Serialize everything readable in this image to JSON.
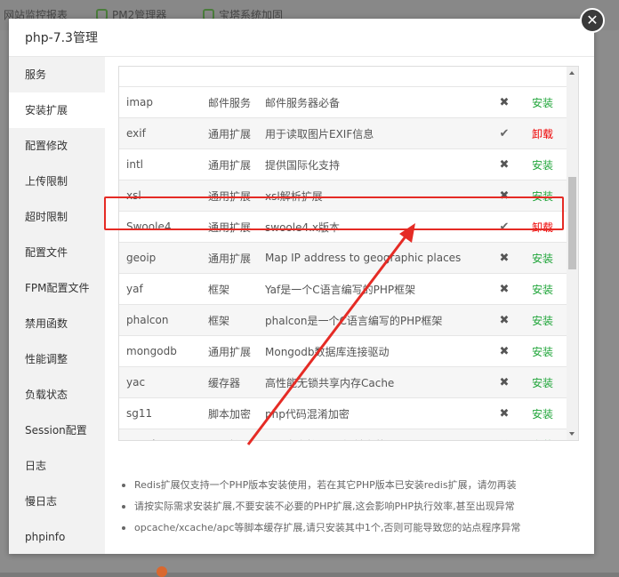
{
  "background": {
    "tabs": [
      "网站监控报表",
      "PM2管理器",
      "宝塔系统加固"
    ]
  },
  "modal": {
    "title": "php-7.3管理",
    "close_icon": "close-icon"
  },
  "sidebar": {
    "items": [
      {
        "label": "服务"
      },
      {
        "label": "安装扩展"
      },
      {
        "label": "配置修改"
      },
      {
        "label": "上传限制"
      },
      {
        "label": "超时限制"
      },
      {
        "label": "配置文件"
      },
      {
        "label": "FPM配置文件"
      },
      {
        "label": "禁用函数"
      },
      {
        "label": "性能调整"
      },
      {
        "label": "负载状态"
      },
      {
        "label": "Session配置"
      },
      {
        "label": "日志"
      },
      {
        "label": "慢日志"
      },
      {
        "label": "phpinfo"
      }
    ],
    "active_index": 1
  },
  "extensions": {
    "rows": [
      {
        "name": "imap",
        "type": "邮件服务",
        "desc": "邮件服务器必备",
        "installed": false,
        "status": "✖",
        "action": "安装"
      },
      {
        "name": "exif",
        "type": "通用扩展",
        "desc": "用于读取图片EXIF信息",
        "installed": true,
        "status": "✔",
        "action": "卸载"
      },
      {
        "name": "intl",
        "type": "通用扩展",
        "desc": "提供国际化支持",
        "installed": false,
        "status": "✖",
        "action": "安装"
      },
      {
        "name": "xsl",
        "type": "通用扩展",
        "desc": "xsl解析扩展",
        "installed": false,
        "status": "✖",
        "action": "安装"
      },
      {
        "name": "Swoole4",
        "type": "通用扩展",
        "desc": "swoole4.x版本",
        "installed": true,
        "status": "✔",
        "action": "卸载"
      },
      {
        "name": "geoip",
        "type": "通用扩展",
        "desc": "Map IP address to geographic places",
        "installed": false,
        "status": "✖",
        "action": "安装"
      },
      {
        "name": "yaf",
        "type": "框架",
        "desc": "Yaf是一个C语言编写的PHP框架",
        "installed": false,
        "status": "✖",
        "action": "安装"
      },
      {
        "name": "phalcon",
        "type": "框架",
        "desc": "phalcon是一个C语言编写的PHP框架",
        "installed": false,
        "status": "✖",
        "action": "安装"
      },
      {
        "name": "mongodb",
        "type": "通用扩展",
        "desc": "Mongodb数据库连接驱动",
        "installed": false,
        "status": "✖",
        "action": "安装"
      },
      {
        "name": "yac",
        "type": "缓存器",
        "desc": "高性能无锁共享内存Cache",
        "installed": false,
        "status": "✖",
        "action": "安装"
      },
      {
        "name": "sg11",
        "type": "脚本加密",
        "desc": "php代码混淆加密",
        "installed": false,
        "status": "✖",
        "action": "安装"
      },
      {
        "name": "pgsql",
        "type": "通用扩展",
        "desc": "php官方扩展(需提前安装postgresql)",
        "installed": false,
        "status": "✖",
        "action": "安装"
      }
    ]
  },
  "notes": [
    "Redis扩展仅支持一个PHP版本安装使用，若在其它PHP版本已安装redis扩展，请勿再装",
    "请按实际需求安装扩展,不要安装不必要的PHP扩展,这会影响PHP执行效率,甚至出现异常",
    "opcache/xcache/apc等脚本缓存扩展,请只安装其中1个,否则可能导致您的站点程序异常"
  ],
  "colors": {
    "install": "#20a53a",
    "uninstall": "#ee0000",
    "highlight": "#e52b25"
  }
}
